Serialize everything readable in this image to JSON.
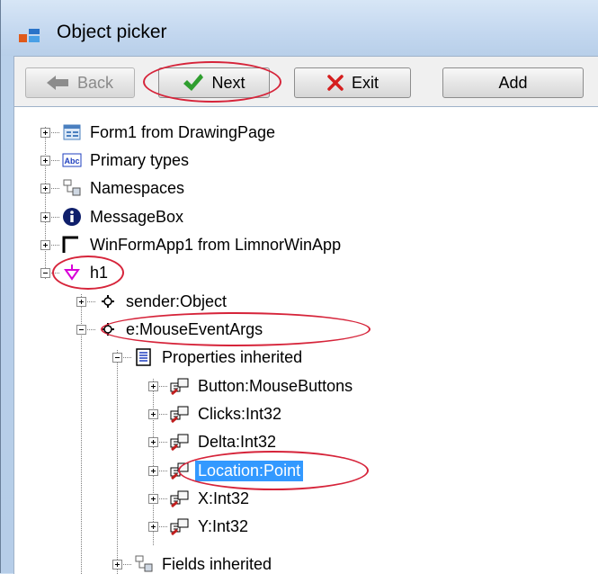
{
  "window": {
    "title": "Object picker"
  },
  "toolbar": {
    "back_label": "Back",
    "next_label": "Next",
    "exit_label": "Exit",
    "add_label": "Add"
  },
  "tree": {
    "nodes": [
      {
        "label": "Form1 from DrawingPage",
        "icon": "form-icon"
      },
      {
        "label": "Primary types",
        "icon": "abc-icon"
      },
      {
        "label": "Namespaces",
        "icon": "namespace-icon"
      },
      {
        "label": "MessageBox",
        "icon": "info-icon"
      },
      {
        "label": "WinFormApp1 from LimnorWinApp",
        "icon": "app-icon"
      },
      {
        "label": "h1",
        "icon": "handler-icon"
      },
      {
        "label": "sender:Object",
        "icon": "parameter-icon"
      },
      {
        "label": "e:MouseEventArgs",
        "icon": "parameter-icon"
      },
      {
        "label": "Properties inherited",
        "icon": "properties-icon"
      },
      {
        "label": "Button:MouseButtons",
        "icon": "property-icon"
      },
      {
        "label": "Clicks:Int32",
        "icon": "property-icon"
      },
      {
        "label": "Delta:Int32",
        "icon": "property-icon"
      },
      {
        "label": "Location:Point",
        "icon": "property-icon",
        "selected": true
      },
      {
        "label": "X:Int32",
        "icon": "property-icon"
      },
      {
        "label": "Y:Int32",
        "icon": "property-icon"
      },
      {
        "label": "Fields inherited",
        "icon": "namespace-icon"
      }
    ]
  },
  "annotation_color": "#d6243a",
  "selection_color": "#3399ff"
}
